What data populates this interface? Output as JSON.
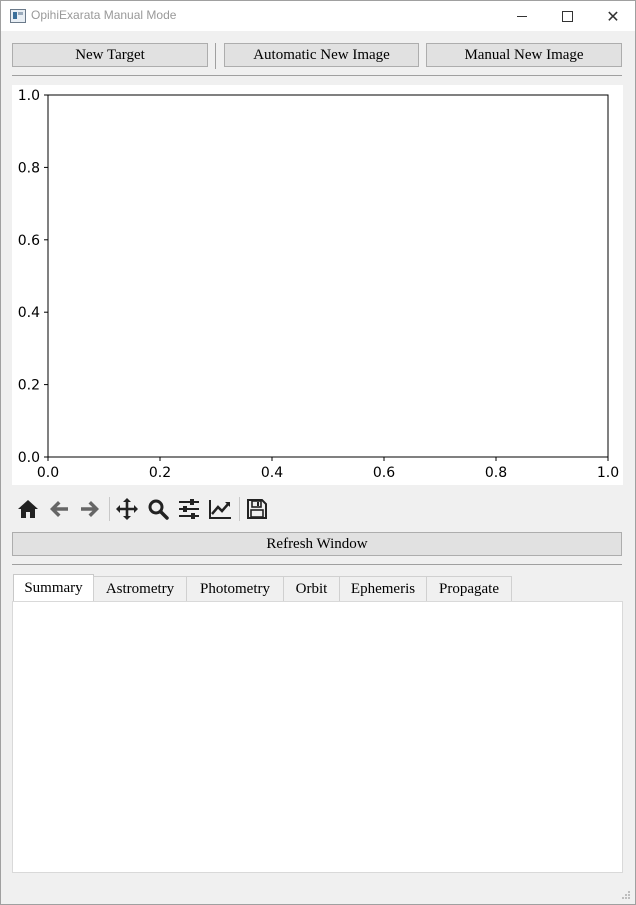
{
  "window": {
    "title": "OpihiExarata Manual Mode",
    "icons": {
      "app": "app-window-icon",
      "minimize": "minimize-icon",
      "maximize": "maximize-icon",
      "close": "close-icon"
    },
    "close_glyph": "✕"
  },
  "top_buttons": {
    "new_target": "New Target",
    "automatic_new_image": "Automatic New Image",
    "manual_new_image": "Manual New Image"
  },
  "plot": {
    "x_ticks": [
      "0.0",
      "0.2",
      "0.4",
      "0.6",
      "0.8",
      "1.0"
    ],
    "y_ticks": [
      "0.0",
      "0.2",
      "0.4",
      "0.6",
      "0.8",
      "1.0"
    ]
  },
  "chart_data": {
    "type": "scatter",
    "title": "",
    "xlabel": "",
    "ylabel": "",
    "xlim": [
      0,
      1
    ],
    "ylim": [
      0,
      1
    ],
    "x_ticks": [
      0.0,
      0.2,
      0.4,
      0.6,
      0.8,
      1.0
    ],
    "y_ticks": [
      0.0,
      0.2,
      0.4,
      0.6,
      0.8,
      1.0
    ],
    "series": [],
    "grid": false
  },
  "toolbar": {
    "icons": [
      "home-icon",
      "back-arrow-icon",
      "forward-arrow-icon",
      "pan-icon",
      "zoom-icon",
      "configure-subplots-icon",
      "edit-axis-icon",
      "save-icon"
    ]
  },
  "refresh_button": "Refresh Window",
  "tabs": [
    {
      "label": "Summary",
      "active": true
    },
    {
      "label": "Astrometry",
      "active": false
    },
    {
      "label": "Photometry",
      "active": false
    },
    {
      "label": "Orbit",
      "active": false
    },
    {
      "label": "Ephemeris",
      "active": false
    },
    {
      "label": "Propagate",
      "active": false
    }
  ],
  "colors": {
    "window_bg": "#f0f0f0",
    "button_bg": "#e1e1e1",
    "button_border": "#adadad",
    "plot_bg": "#ffffff",
    "toolbar_icon": "#222222",
    "toolbar_icon_disabled": "#666666"
  }
}
